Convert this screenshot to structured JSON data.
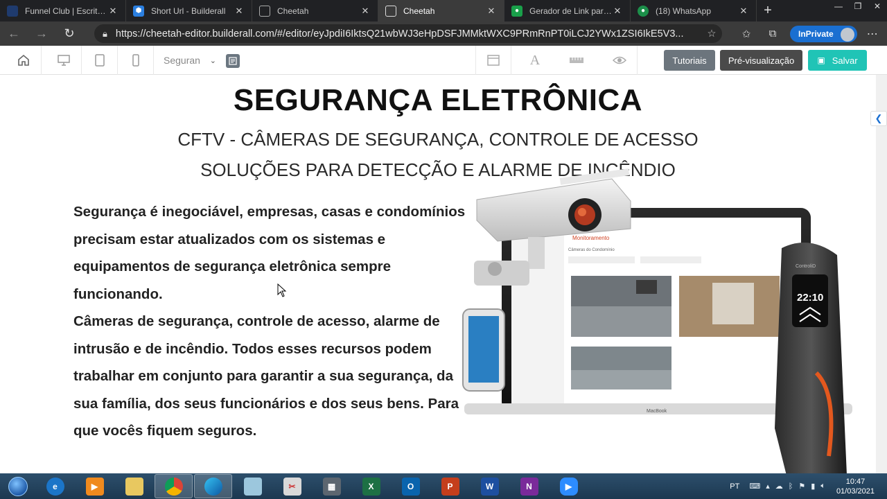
{
  "browser": {
    "tabs": [
      {
        "title": "Funnel Club | Escritório V",
        "fav_color": "#1f3b6e",
        "active": false
      },
      {
        "title": "Short Url - Builderall",
        "fav_color": "#2b7fe0",
        "active": false
      },
      {
        "title": "Cheetah",
        "fav_color": "#555555",
        "active": false
      },
      {
        "title": "Cheetah",
        "fav_color": "#555555",
        "active": true
      },
      {
        "title": "Gerador de Link para Wh",
        "fav_color": "#19a04a",
        "active": false
      },
      {
        "title": "(18) WhatsApp",
        "fav_color": "#1c8f4a",
        "active": false
      }
    ],
    "url": "https://cheetah-editor.builderall.com/#/editor/eyJpdiI6IktsQ21wbWJ3eHpDSFJMMktWXC9PRmRnPT0iLCJ2YWx1ZSI6IkE5V3...",
    "inprivate_label": "InPrivate"
  },
  "editor": {
    "page_select": "Seguran",
    "buttons": {
      "tutorials": "Tutoriais",
      "preview": "Pré-visualização",
      "save": "Salvar"
    }
  },
  "page": {
    "title": "SEGURANÇA ELETRÔNICA",
    "subtitle_1": "CFTV - CÂMERAS DE SEGURANÇA, CONTROLE DE ACESSO",
    "subtitle_2": "SOLUÇÕES PARA DETECÇÃO E ALARME DE INCÊNDIO",
    "paragraph_1": "Segurança é inegociável, empresas, casas e condomínios precisam estar atualizados com os sistemas e equipamentos de segurança eletrônica sempre funcionando.",
    "paragraph_2": "Câmeras de segurança, controle de acesso, alarme de intrusão e de incêndio. Todos esses recursos podem trabalhar em conjunto para garantir a sua segurança, da sua família, dos seus funcionários e dos seus bens. Para que vocês fiquem seguros."
  },
  "illustration": {
    "app_title": "Monitoramento",
    "app_subtitle": "Câmeras do Condomínio",
    "device_time": "22:10",
    "laptop_brand": "MacBook",
    "device_brand": "ControliD"
  },
  "taskbar": {
    "lang": "PT",
    "time": "10:47",
    "date": "01/03/2021"
  }
}
